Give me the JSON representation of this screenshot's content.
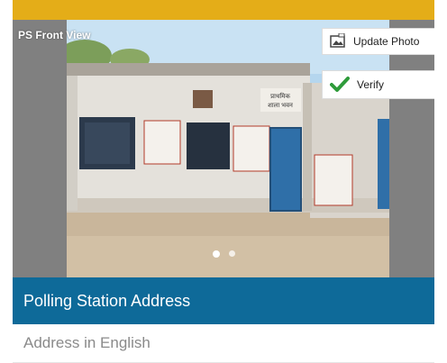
{
  "photo": {
    "label": "PS Front View",
    "sign_text_1": "प्राथमिक",
    "sign_text_2": "शाला भवन",
    "slide_count": 2,
    "active_slide": 1
  },
  "actions": {
    "update_photo_label": "Update Photo",
    "verify_label": "Verify"
  },
  "section": {
    "title": "Polling Station Address"
  },
  "fields": {
    "address_english_label": "Address in English"
  },
  "colors": {
    "top_strip": "#e4ad18",
    "section_header": "#0e6a99",
    "verify_check": "#2e9b3a"
  },
  "icons": {
    "update_photo": "image-edit-icon",
    "verify": "checkmark-icon"
  }
}
